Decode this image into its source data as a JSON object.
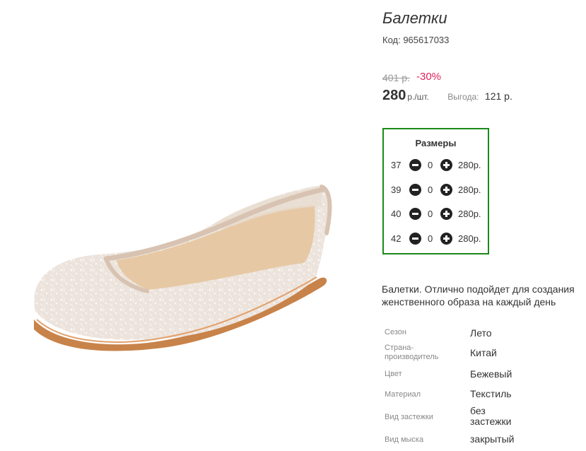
{
  "product": {
    "title": "Балетки",
    "code": "Код: 965617033",
    "old_price": "401 р.",
    "discount": "-30%",
    "price": "280",
    "price_unit": "р./шт.",
    "savings_label": "Выгода:",
    "savings_value": "121 р."
  },
  "sizes": {
    "title": "Размеры",
    "items": [
      {
        "size": "37",
        "qty": "0",
        "price": "280р."
      },
      {
        "size": "39",
        "qty": "0",
        "price": "280р."
      },
      {
        "size": "40",
        "qty": "0",
        "price": "280р."
      },
      {
        "size": "42",
        "qty": "0",
        "price": "280р."
      }
    ]
  },
  "description": "Балетки. Отлично подойдет для создания женственного образа на каждый день",
  "properties": [
    {
      "label": "Сезон",
      "value": "Лето"
    },
    {
      "label": "Страна-производитель",
      "value": "Китай"
    },
    {
      "label": "Цвет",
      "value": "Бежевый"
    },
    {
      "label": "Материал",
      "value": "Текстиль"
    },
    {
      "label": "Вид застежки",
      "value": "без застежки"
    },
    {
      "label": "Вид мыска",
      "value": "закрытый"
    }
  ],
  "colors": {
    "accent_green": "#1a8a1a",
    "discount_red": "#e0245e"
  }
}
